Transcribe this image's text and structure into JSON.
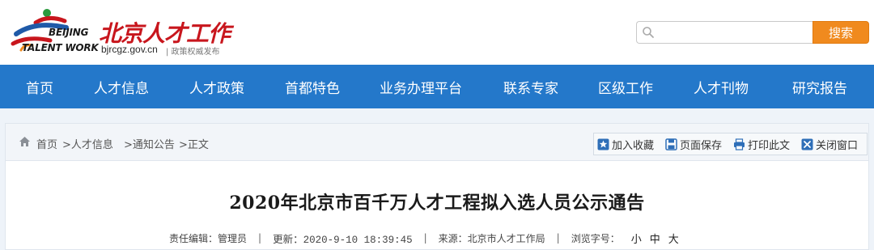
{
  "header": {
    "logo": {
      "en_line1": "BEIJING",
      "en_line2": "TALENT WORK",
      "cn_name": "北京人才工作",
      "url": "bjrcgz.gov.cn",
      "slogan": "| 政策权威发布"
    },
    "search": {
      "placeholder": "",
      "value": "",
      "button_label": "搜索"
    }
  },
  "nav": {
    "items": [
      {
        "label": "首页"
      },
      {
        "label": "人才信息"
      },
      {
        "label": "人才政策"
      },
      {
        "label": "首都特色"
      },
      {
        "label": "业务办理平台"
      },
      {
        "label": "联系专家"
      },
      {
        "label": "区级工作"
      },
      {
        "label": "人才刊物"
      },
      {
        "label": "研究报告"
      }
    ]
  },
  "breadcrumb": {
    "items": [
      "首页",
      ">人才信息",
      ">通知公告",
      ">正文"
    ]
  },
  "toolbar": {
    "items": [
      {
        "label": "加入收藏",
        "icon": "star-icon"
      },
      {
        "label": "页面保存",
        "icon": "save-icon"
      },
      {
        "label": "打印此文",
        "icon": "print-icon"
      },
      {
        "label": "关闭窗口",
        "icon": "close-icon"
      }
    ]
  },
  "article": {
    "title": "2020年北京市百千万人才工程拟入选人员公示通告",
    "meta": {
      "editor": "责任编辑：管理员",
      "updated": "更新：2020-9-10 18:39:45",
      "source": "来源：北京市人才工作局",
      "font_size_label": "浏览字号：",
      "font_sizes": [
        "小",
        "中",
        "大"
      ]
    }
  },
  "colors": {
    "nav_bg": "#2478ca",
    "search_button": "#f08a1e",
    "logo_red": "#c8161d",
    "logo_blue": "#1f5aa8",
    "logo_green": "#2a9a3e"
  }
}
